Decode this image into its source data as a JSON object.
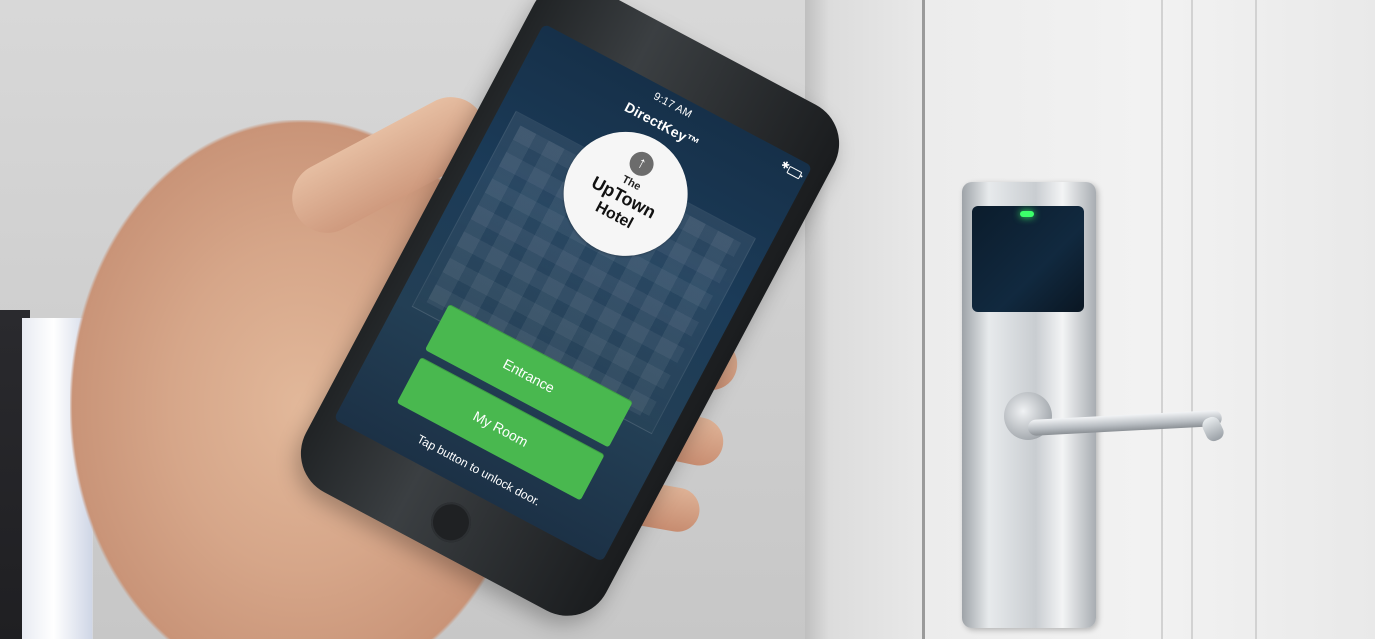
{
  "phone": {
    "status_time": "9:17 AM",
    "app_title": "DirectKey™"
  },
  "hotel_logo": {
    "the": "The",
    "name": "UpTown",
    "hotel": "Hotel"
  },
  "actions": {
    "entrance": "Entrance",
    "my_room": "My Room",
    "hint": "Tap button to unlock door."
  },
  "colors": {
    "button_green": "#49b84f",
    "screen_blue": "#1b3b58",
    "lock_led_green": "#3cff6a"
  },
  "icons": {
    "status_bluetooth": "bluetooth-icon",
    "status_battery": "battery-icon",
    "logo_arrow": "up-arrow-icon"
  }
}
